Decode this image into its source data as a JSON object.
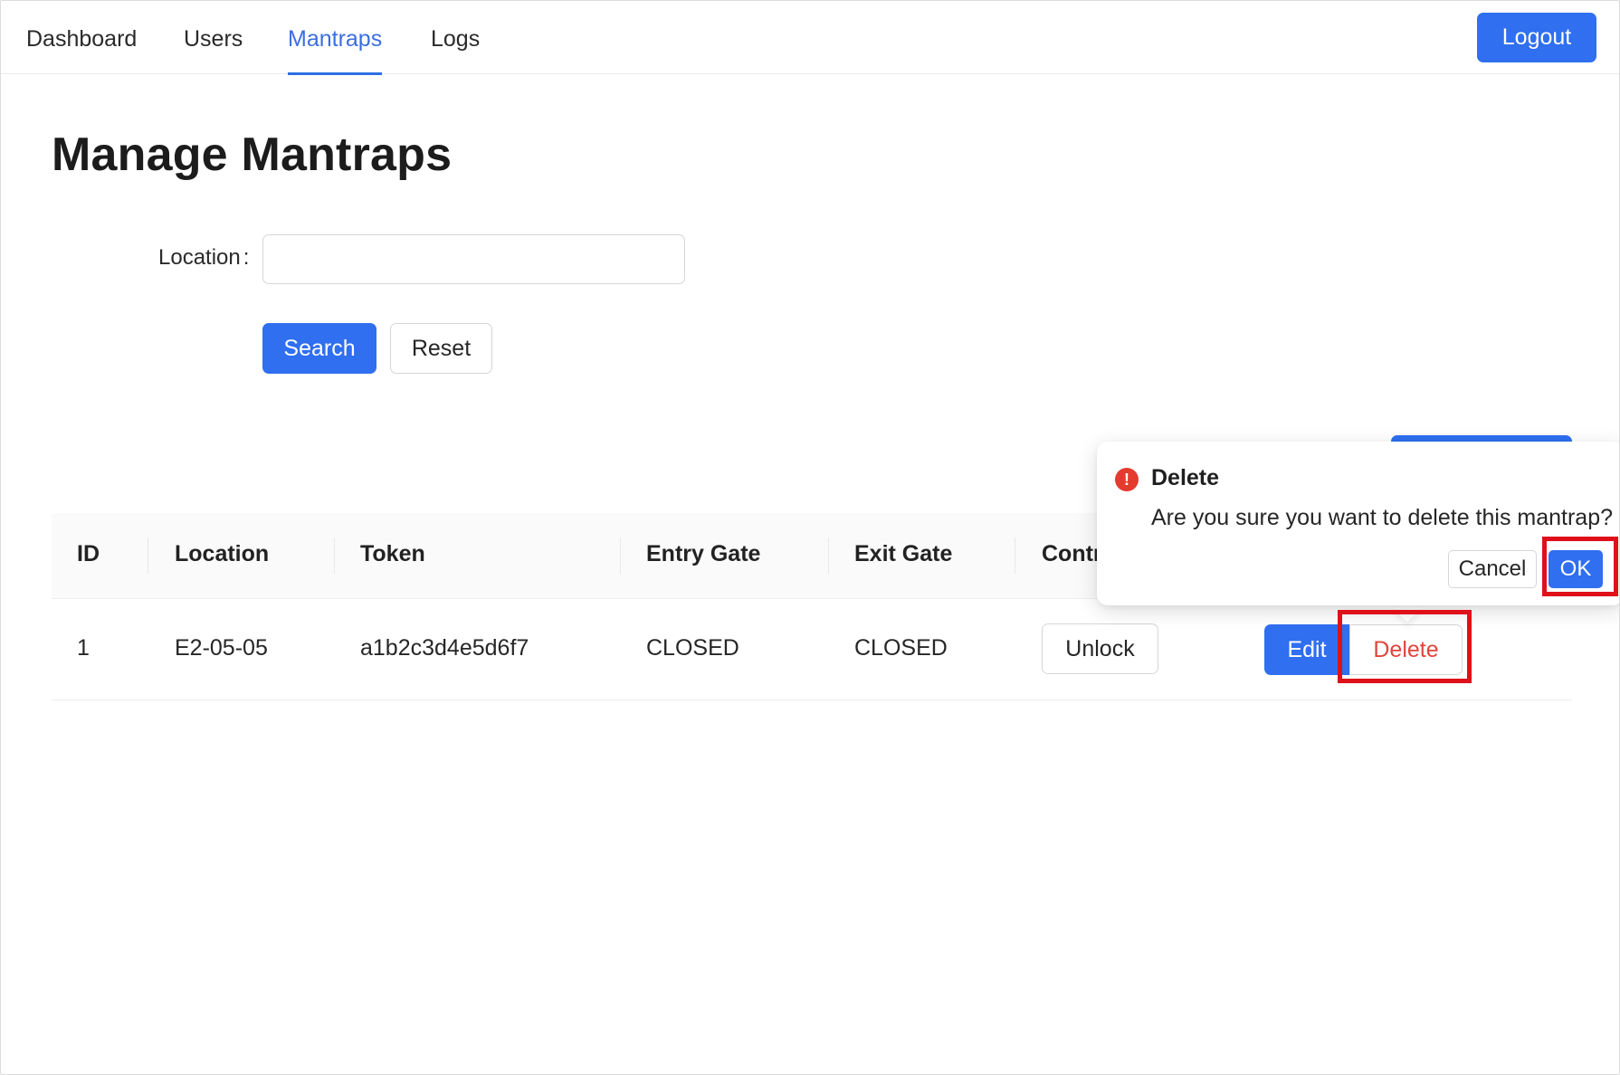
{
  "nav": {
    "items": [
      {
        "label": "Dashboard"
      },
      {
        "label": "Users"
      },
      {
        "label": "Mantraps"
      },
      {
        "label": "Logs"
      }
    ],
    "active": "Mantraps",
    "logout_label": "Logout"
  },
  "page": {
    "title": "Manage Mantraps"
  },
  "search_form": {
    "location_label": "Location",
    "location_colon": ":",
    "location_value": "",
    "search_label": "Search",
    "reset_label": "Reset"
  },
  "table": {
    "columns": [
      "ID",
      "Location",
      "Token",
      "Entry Gate",
      "Exit Gate",
      "Contr"
    ],
    "rows": [
      {
        "id": "1",
        "location": "E2-05-05",
        "token": "a1b2c3d4e5d6f7",
        "entry_gate": "CLOSED",
        "exit_gate": "CLOSED",
        "control_label": "Unlock",
        "edit_label": "Edit",
        "delete_label": "Delete"
      }
    ]
  },
  "popconfirm": {
    "icon": "exclamation-circle-icon",
    "icon_glyph": "!",
    "title": "Delete",
    "description": "Are you sure you want to delete this mantrap?",
    "cancel_label": "Cancel",
    "ok_label": "OK"
  },
  "colors": {
    "primary": "#2f6ff0",
    "danger": "#e0453c",
    "highlight": "#e0101a",
    "nav_active": "#3b6fe0"
  }
}
